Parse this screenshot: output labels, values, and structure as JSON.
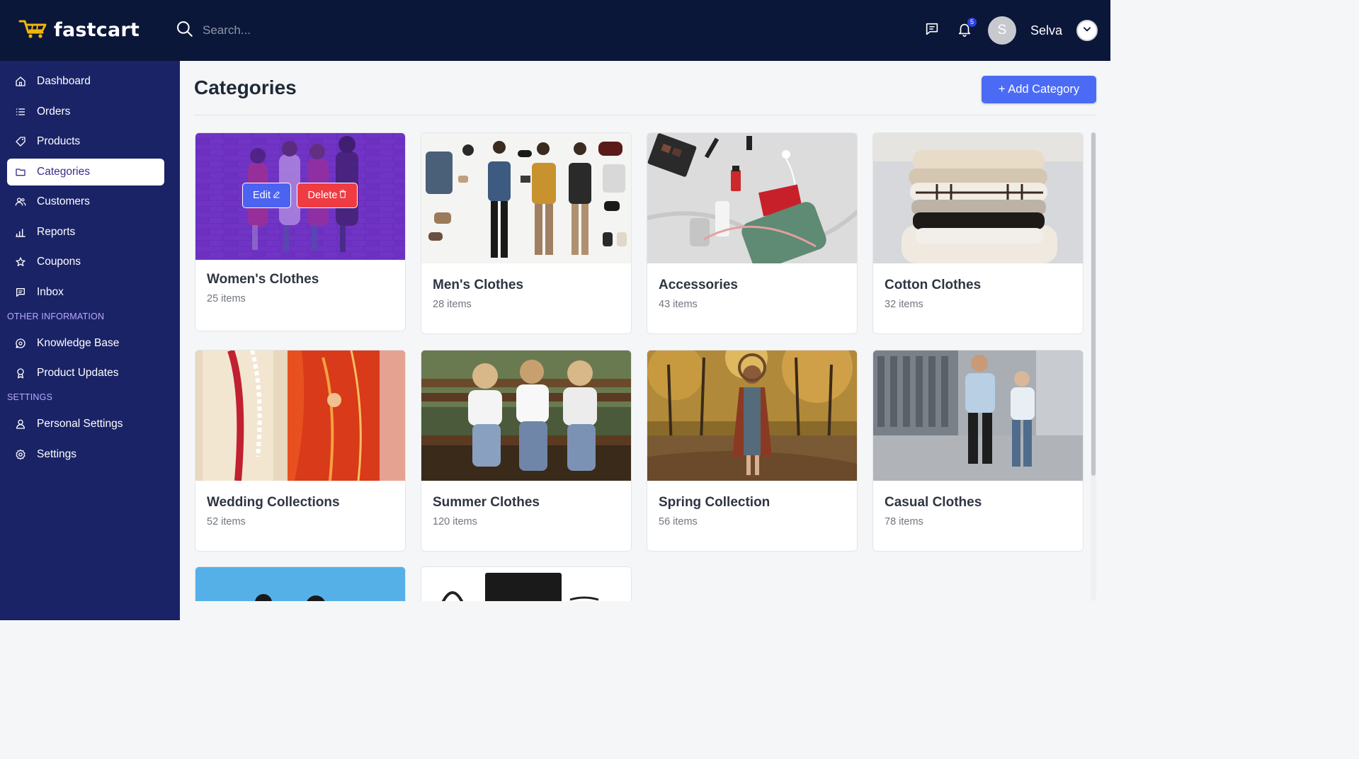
{
  "brand": {
    "name": "fastcart"
  },
  "search": {
    "placeholder": "Search..."
  },
  "header": {
    "notification_count": "5",
    "avatar_initial": "S",
    "username": "Selva"
  },
  "sidebar": {
    "main_items": [
      {
        "label": "Dashboard",
        "icon": "home-icon"
      },
      {
        "label": "Orders",
        "icon": "list-icon"
      },
      {
        "label": "Products",
        "icon": "tag-icon"
      },
      {
        "label": "Categories",
        "icon": "folder-icon"
      },
      {
        "label": "Customers",
        "icon": "users-icon"
      },
      {
        "label": "Reports",
        "icon": "bar-chart-icon"
      },
      {
        "label": "Coupons",
        "icon": "star-icon"
      },
      {
        "label": "Inbox",
        "icon": "message-icon"
      }
    ],
    "other_label": "OTHER INFORMATION",
    "other_items": [
      {
        "label": "Knowledge Base",
        "icon": "chat-circle-icon"
      },
      {
        "label": "Product Updates",
        "icon": "award-icon"
      }
    ],
    "settings_label": "SETTINGS",
    "settings_items": [
      {
        "label": "Personal Settings",
        "icon": "user-icon"
      },
      {
        "label": "Settings",
        "icon": "gear-icon"
      }
    ],
    "active": "Categories"
  },
  "page": {
    "title": "Categories",
    "add_button": "+ Add Category"
  },
  "hover_actions": {
    "edit": "Edit",
    "delete": "Delete"
  },
  "categories": [
    {
      "name": "Women's Clothes",
      "count": "25 items"
    },
    {
      "name": "Men's Clothes",
      "count": "28 items"
    },
    {
      "name": "Accessories",
      "count": "43 items"
    },
    {
      "name": "Cotton Clothes",
      "count": "32 items"
    },
    {
      "name": "Wedding Collections",
      "count": "52 items"
    },
    {
      "name": "Summer Clothes",
      "count": "120 items"
    },
    {
      "name": "Spring Collection",
      "count": "56 items"
    },
    {
      "name": "Casual Clothes",
      "count": "78 items"
    },
    {
      "name": "",
      "count": ""
    },
    {
      "name": "",
      "count": ""
    }
  ],
  "colors": {
    "topbar": "#0b1739",
    "sidebar": "#1a2366",
    "accent": "#4b6bf5",
    "danger": "#ef3b42",
    "section_label": "#b9a8ff"
  }
}
